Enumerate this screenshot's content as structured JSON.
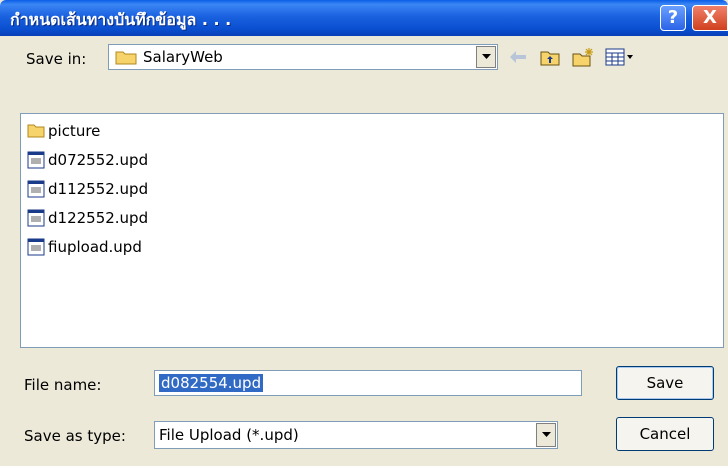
{
  "dialog": {
    "title": "กำหนดเส้นทางบันทึกข้อมูล . . .",
    "help_label": "?",
    "close_label": "X"
  },
  "toolbar": {
    "save_in_label": "Save in:",
    "save_in_value": "SalaryWeb",
    "icons": [
      "back-arrow-icon",
      "up-folder-icon",
      "new-folder-icon",
      "view-menu-icon"
    ]
  },
  "files": [
    {
      "name": "picture",
      "icon": "folder-icon"
    },
    {
      "name": "d072552.upd",
      "icon": "file-icon"
    },
    {
      "name": "d112552.upd",
      "icon": "file-icon"
    },
    {
      "name": "d122552.upd",
      "icon": "file-icon"
    },
    {
      "name": "fiupload.upd",
      "icon": "file-icon"
    }
  ],
  "form": {
    "file_name_label": "File name:",
    "file_name_value": "d082554.upd",
    "save_as_type_label": "Save as type:",
    "save_as_type_value": "File Upload (*.upd)"
  },
  "buttons": {
    "save": "Save",
    "cancel": "Cancel"
  },
  "colors": {
    "title_bar": "#0a5ee8",
    "dialog_bg": "#ece9d8",
    "selection": "#316ac5"
  }
}
